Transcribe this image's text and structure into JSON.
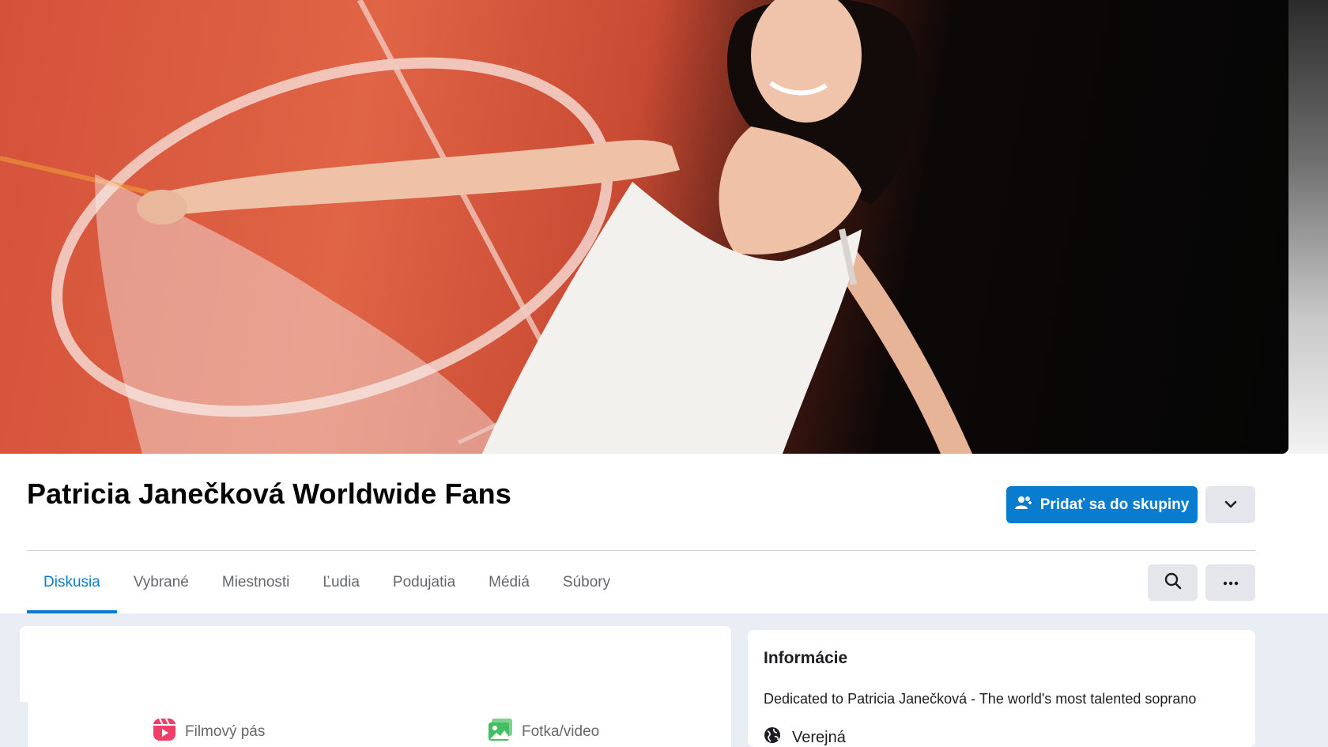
{
  "group": {
    "title": "Patricia Janečková Worldwide Fans",
    "join_label": "Pridať sa do skupiny"
  },
  "tabs": [
    {
      "label": "Diskusia",
      "active": true
    },
    {
      "label": "Vybrané",
      "active": false
    },
    {
      "label": "Miestnosti",
      "active": false
    },
    {
      "label": "Ľudia",
      "active": false
    },
    {
      "label": "Podujatia",
      "active": false
    },
    {
      "label": "Médiá",
      "active": false
    },
    {
      "label": "Súbory",
      "active": false
    }
  ],
  "composer": {
    "reel_label": "Filmový pás",
    "photo_label": "Fotka/video"
  },
  "info": {
    "title": "Informácie",
    "description": "Dedicated to Patricia Janečková - The world's most talented soprano",
    "privacy": "Verejná"
  },
  "colors": {
    "accent": "#0a7cd0",
    "reel_icon": "#f0406a",
    "photo_icon": "#45bd62"
  },
  "icons": {
    "join": "people-add-icon",
    "dropdown": "chevron-down-icon",
    "search": "search-icon",
    "more": "more-dots-icon",
    "reel": "reel-icon",
    "photo": "photo-icon",
    "privacy": "globe-icon"
  }
}
